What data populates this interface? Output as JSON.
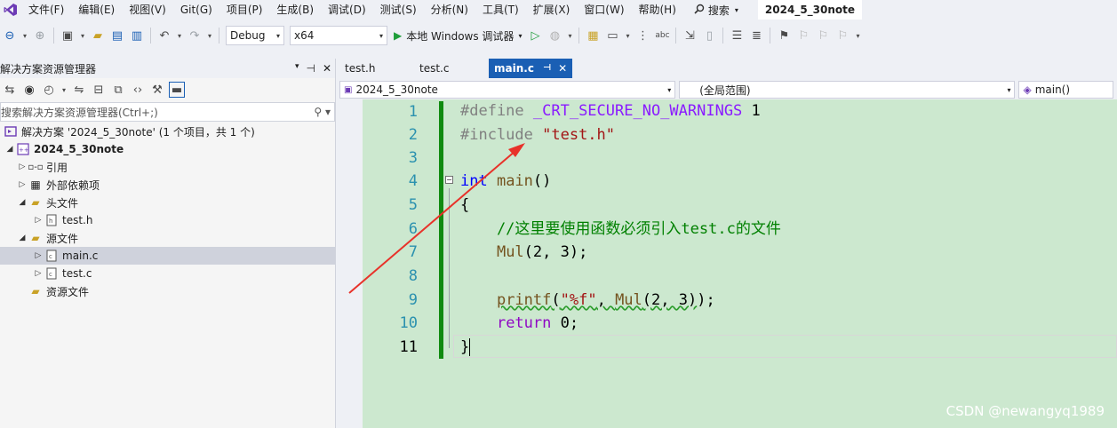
{
  "menu": {
    "items": [
      "文件(F)",
      "编辑(E)",
      "视图(V)",
      "Git(G)",
      "项目(P)",
      "生成(B)",
      "调试(D)",
      "测试(S)",
      "分析(N)",
      "工具(T)",
      "扩展(X)",
      "窗口(W)",
      "帮助(H)"
    ],
    "search_label": "搜索",
    "solution_name": "2024_5_30note"
  },
  "toolbar": {
    "config": "Debug",
    "platform": "x64",
    "run_label": "本地 Windows 调试器"
  },
  "solution_explorer": {
    "title": "解决方案资源管理器",
    "search_placeholder": "搜索解决方案资源管理器(Ctrl+;)",
    "tree": [
      {
        "label": "解决方案 '2024_5_30note' (1 个项目，共 1 个)"
      },
      {
        "label": "2024_5_30note"
      },
      {
        "label": "引用"
      },
      {
        "label": "外部依赖项"
      },
      {
        "label": "头文件"
      },
      {
        "label": "test.h"
      },
      {
        "label": "源文件"
      },
      {
        "label": "main.c"
      },
      {
        "label": "test.c"
      },
      {
        "label": "资源文件"
      }
    ]
  },
  "tabs": [
    {
      "label": "test.h"
    },
    {
      "label": "test.c"
    },
    {
      "label": "main.c"
    }
  ],
  "navbar": {
    "project": "2024_5_30note",
    "scope": "(全局范围)",
    "member": "main()"
  },
  "editor": {
    "current_line": 11,
    "line_numbers": [
      "1",
      "2",
      "3",
      "4",
      "5",
      "6",
      "7",
      "8",
      "9",
      "10",
      "11"
    ],
    "code": {
      "l1": {
        "directive": "#define ",
        "macro": "_CRT_SECURE_NO_WARNINGS",
        "value": " 1"
      },
      "l2": {
        "directive": "#include ",
        "path": "\"test.h\""
      },
      "l4": {
        "type": "int",
        "name": " main",
        "rest": "()"
      },
      "l5": "{",
      "l6": "    //这里要使用函数必须引入test.c的文件",
      "l7": {
        "indent": "    ",
        "call": "Mul",
        "args": "(2, 3);"
      },
      "l9": {
        "indent": "    ",
        "call": "printf",
        "open": "(",
        "fmt": "\"%f\"",
        "comma": ", ",
        "inner": "Mul",
        "args": "(2, 3)",
        "close": ");"
      },
      "l10": {
        "indent": "    ",
        "kw": "return",
        "value": " 0;"
      },
      "l11": "}"
    }
  },
  "watermark": "CSDN @newangyq1989",
  "colors": {
    "editor_bg": "#cce8cf",
    "active_tab": "#1a5fb4",
    "change_bar": "#108a10",
    "annotation_arrow": "#e8322a"
  }
}
